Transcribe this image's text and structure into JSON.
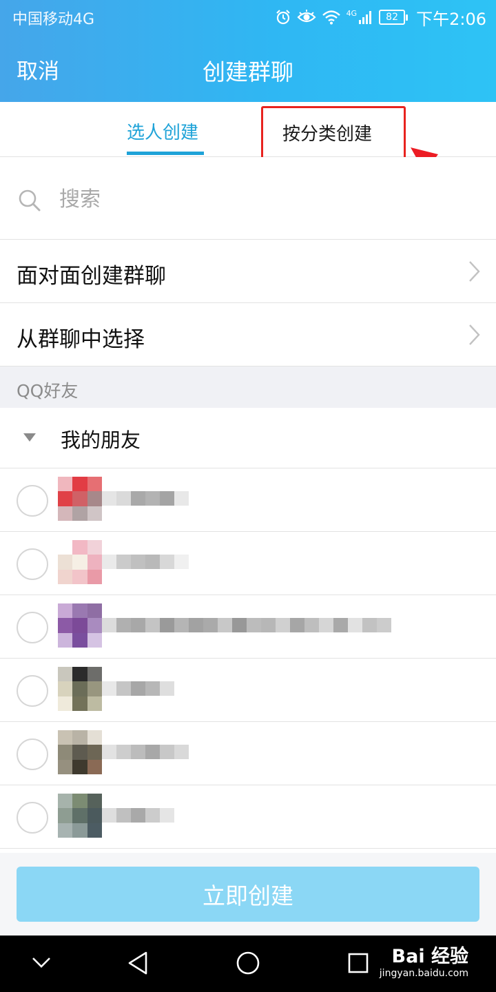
{
  "status_bar": {
    "carrier": "中国移动4G",
    "battery": "82",
    "network_tag": "4G",
    "time": "下午2:06"
  },
  "header": {
    "cancel_label": "取消",
    "title": "创建群聊"
  },
  "tabs": [
    {
      "label": "选人创建",
      "active": true
    },
    {
      "label": "按分类创建",
      "active": false,
      "highlighted": true
    }
  ],
  "search": {
    "placeholder": "搜索"
  },
  "menu": [
    {
      "label": "面对面创建群聊"
    },
    {
      "label": "从群聊中选择"
    }
  ],
  "section": {
    "label": "QQ好友"
  },
  "group": {
    "label": "我的朋友",
    "expanded": true
  },
  "friends": [
    {
      "avatar": [
        "#f0b7be",
        "#e23c44",
        "#e66f73",
        "#e04147",
        "#d06166",
        "#a7888a",
        "#d4b7ba",
        "#b0a3a4",
        "#d0c5c6"
      ],
      "name": [
        "#e5e5e5",
        "#dadada",
        "#a9a9a9",
        "#b3b3b3",
        "#a4a4a4",
        "#e8e8e8"
      ]
    },
    {
      "avatar": [
        "#ffffff",
        "#f2b8c4",
        "#f1d2d9",
        "#ece0d5",
        "#f6efe5",
        "#eeb2bf",
        "#f0d4ce",
        "#f2c4c9",
        "#e99aa7"
      ],
      "name": [
        "#eaeaea",
        "#cbcbcb",
        "#c0c0c0",
        "#b9b9b9",
        "#d8d8d8",
        "#f0f0f0"
      ]
    },
    {
      "avatar": [
        "#c9aad6",
        "#9a79b1",
        "#8f6ea4",
        "#8c5aa6",
        "#7c4a98",
        "#a98bbf",
        "#ccb5dc",
        "#7a4e9e",
        "#d5c3e3"
      ],
      "name": [
        "#dcdcdc",
        "#b0b0b0",
        "#a8a8a8",
        "#c4c4c4",
        "#9a9a9a",
        "#b5b5b5",
        "#a2a2a2",
        "#aaaaaa",
        "#c8c8c8",
        "#989898",
        "#bcbcbc",
        "#b7b7b7",
        "#d0d0d0",
        "#a6a6a6",
        "#bebebe",
        "#d6d6d6",
        "#a9a9a9",
        "#e2e2e2",
        "#c2c2c2",
        "#cccccc"
      ]
    },
    {
      "avatar": [
        "#c9c7bd",
        "#2b2b2b",
        "#6d6d6a",
        "#d8d3bd",
        "#6b6d58",
        "#98967f",
        "#efeadb",
        "#737259",
        "#bdbba2"
      ],
      "name": [
        "#e8e8e8",
        "#c5c5c5",
        "#a7a7a7",
        "#b7b7b7",
        "#dedede"
      ]
    },
    {
      "avatar": [
        "#c9c2b3",
        "#b9b3a6",
        "#e4dfd5",
        "#8e8a78",
        "#5e5b50",
        "#6d6655",
        "#96907f",
        "#3f3a2e",
        "#8a6a55"
      ],
      "name": [
        "#e2e2e2",
        "#cdcdcd",
        "#bcbcbc",
        "#a8a8a8",
        "#c8c8c8",
        "#d9d9d9"
      ]
    },
    {
      "avatar": [
        "#a6b3ab",
        "#7c8c73",
        "#56625b",
        "#8e9d92",
        "#5f7068",
        "#4b5a5d",
        "#a7b3b1",
        "#8b9a98",
        "#4c5c63"
      ],
      "name": [
        "#dedede",
        "#c0c0c0",
        "#a9a9a9",
        "#cccccc",
        "#e5e5e5"
      ]
    }
  ],
  "create_button": {
    "label": "立即创建",
    "enabled": false
  },
  "navbar": {
    "icons": [
      "back-chevron-icon",
      "back-triangle-icon",
      "home-circle-icon",
      "recents-square-icon"
    ]
  },
  "watermark": {
    "main": "Bai 经验",
    "sub": "jingyan.baidu.com"
  },
  "colors": {
    "header_gradient_start": "#45a6ea",
    "header_gradient_end": "#2ec3f5",
    "accent": "#1fa3d8",
    "highlight_red": "#e8231f",
    "button_disabled": "#8bd7f5"
  }
}
